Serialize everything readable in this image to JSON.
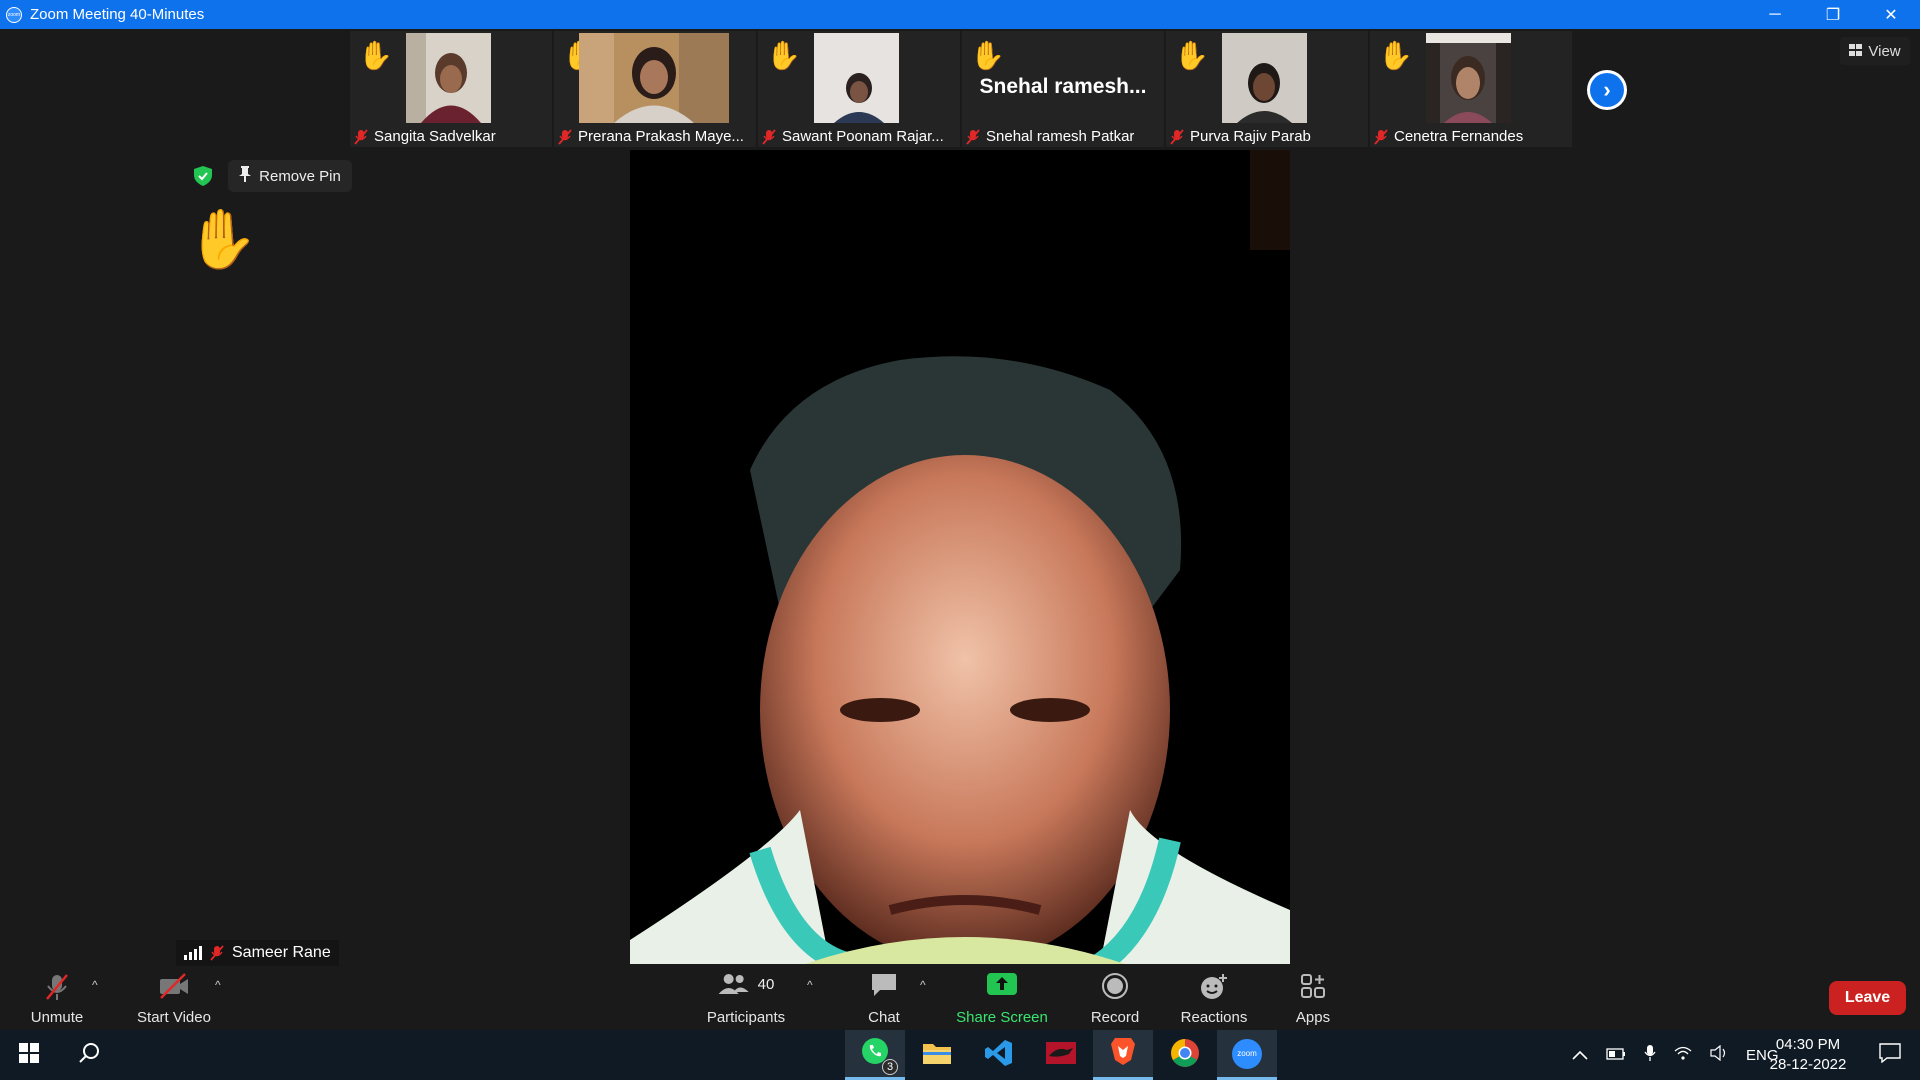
{
  "window": {
    "title": "Zoom Meeting 40-Minutes",
    "app_icon_text": "zoom",
    "minimize": "─",
    "restore": "❐",
    "close": "✕"
  },
  "gallery": {
    "tiles": [
      {
        "name": "Sangita Sadvelkar",
        "hand": "✋",
        "kind": "photo"
      },
      {
        "name": "Prerana Prakash Maye...",
        "hand": "✋",
        "kind": "photo-wide"
      },
      {
        "name": "Sawant Poonam Rajar...",
        "hand": "✋",
        "kind": "photo"
      },
      {
        "name": "Snehal ramesh Patkar",
        "hand": "✋",
        "kind": "text",
        "display": "Snehal  ramesh..."
      },
      {
        "name": "Purva Rajiv Parab",
        "hand": "✋",
        "kind": "photo"
      },
      {
        "name": "Cenetra Fernandes",
        "hand": "✋",
        "kind": "photo"
      }
    ],
    "next_icon": "›"
  },
  "view_button": {
    "label": "View"
  },
  "pin": {
    "remove_label": "Remove Pin",
    "hand": "✋"
  },
  "main": {
    "speaker_name": "Sameer Rane"
  },
  "toolbar": {
    "unmute": "Unmute",
    "start_video": "Start Video",
    "participants": "Participants",
    "participants_count": "40",
    "chat": "Chat",
    "share_screen": "Share Screen",
    "record": "Record",
    "reactions": "Reactions",
    "apps": "Apps",
    "leave": "Leave",
    "caret": "^"
  },
  "taskbar": {
    "whatsapp_badge": "3",
    "language": "ENG",
    "time": "04:30 PM",
    "date": "28-12-2022",
    "zoom_label": "zoom"
  },
  "colors": {
    "titlebar": "#0e72ed",
    "share_green": "#39e672",
    "leave_red": "#cc2121",
    "shield_green": "#23c552"
  }
}
